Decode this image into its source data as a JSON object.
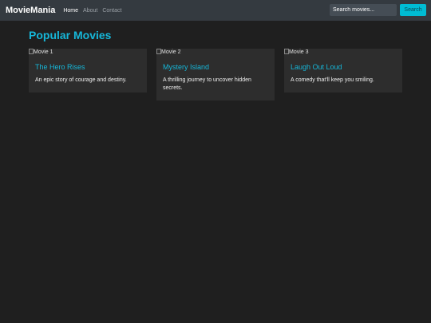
{
  "navbar": {
    "brand": "MovieMania",
    "links": [
      {
        "label": "Home",
        "active": true
      },
      {
        "label": "About",
        "active": false
      },
      {
        "label": "Contact",
        "active": false
      }
    ],
    "search": {
      "placeholder": "Search movies...",
      "button_label": "Search"
    }
  },
  "main": {
    "title": "Popular Movies",
    "movies": [
      {
        "image_alt": "Movie 1",
        "title": "The Hero Rises",
        "description": "An epic story of courage and destiny."
      },
      {
        "image_alt": "Movie 2",
        "title": "Mystery Island",
        "description": "A thrilling journey to uncover hidden secrets."
      },
      {
        "image_alt": "Movie 3",
        "title": "Laugh Out Loud",
        "description": "A comedy that'll keep you smiling."
      }
    ]
  },
  "colors": {
    "accent": "#16b7d9",
    "navbar_bg": "#343a40",
    "page_bg": "#1f1f1f",
    "card_bg": "#2d2d2d",
    "button_bg": "#00bcd4"
  }
}
